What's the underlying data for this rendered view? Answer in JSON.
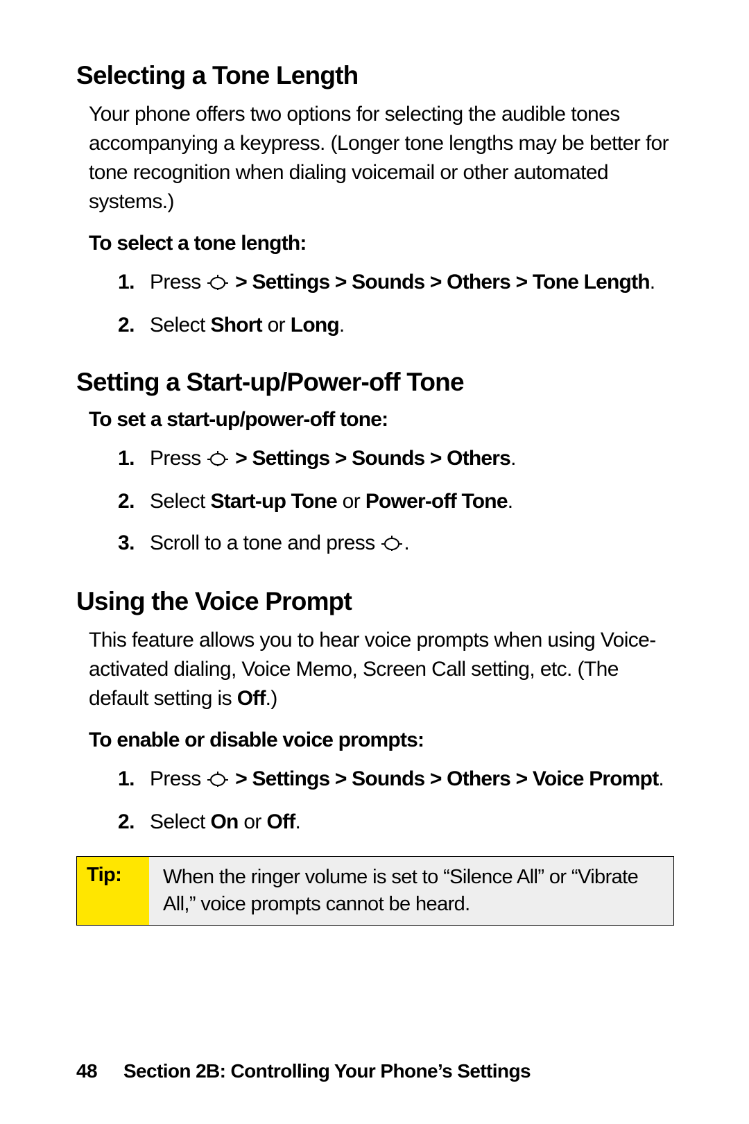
{
  "h1": "Selecting a Tone Length",
  "p1": "Your phone offers two options for selecting the audible tones accompanying a keypress. (Longer tone lengths may be better for tone recognition when dialing voicemail or other automated systems.)",
  "sub1": "To select a tone length:",
  "s1a_press": "Press",
  "s1a_path": " > Settings > Sounds > Others > Tone Length",
  "s1b_select": "Select ",
  "s1b_opt1": "Short",
  "s1b_or": " or ",
  "s1b_opt2": "Long",
  "h2": "Setting a Start-up/Power-off Tone",
  "sub2": "To set a start-up/power-off tone:",
  "s2a_press": "Press",
  "s2a_path": " > Settings > Sounds > Others",
  "s2b_select": "Select ",
  "s2b_opt1": "Start-up Tone",
  "s2b_or": " or ",
  "s2b_opt2": "Power-off Tone",
  "s2c_a": "Scroll to a tone and press",
  "s2c_b": ".",
  "h3": "Using the Voice Prompt",
  "p3a": "This feature allows you to hear voice prompts when using Voice-activated dialing, Voice Memo, Screen Call setting, etc. (The default setting is ",
  "p3b_off": "Off",
  "p3c": ".)",
  "sub3": "To enable or disable voice prompts:",
  "s3a_press": "Press",
  "s3a_path": " > Settings > Sounds > Others > Voice Prompt",
  "s3b_select": "Select ",
  "s3b_opt1": "On",
  "s3b_or": " or ",
  "s3b_opt2": "Off",
  "tip_label": "Tip:",
  "tip_body": "When the ringer volume is set to “Silence All” or “Vibrate All,” voice prompts cannot be heard.",
  "page_number": "48",
  "footer_text": "Section 2B: Controlling Your Phone’s Settings",
  "period": "."
}
